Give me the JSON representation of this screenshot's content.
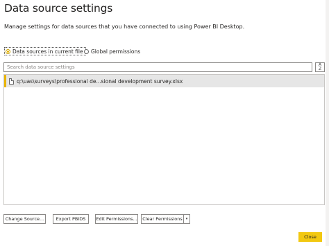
{
  "dialog": {
    "title": "Data source settings",
    "subtitle": "Manage settings for data sources that you have connected to using Power BI Desktop."
  },
  "scope": {
    "options": [
      {
        "label": "Data sources in current file",
        "selected": true
      },
      {
        "label": "Global permissions",
        "selected": false
      }
    ]
  },
  "search": {
    "placeholder": "Search data source settings",
    "sort_icon": "sort-az-icon",
    "sort_glyph_top": "A",
    "sort_glyph_bottom": "Z"
  },
  "sources": [
    {
      "label": "q:\\uas\\surveys\\professional de...sional development survey.xlsx",
      "icon": "file-icon",
      "selected": true
    }
  ],
  "buttons": {
    "change_source": "Change Source...",
    "export_pbids": "Export PBIDS",
    "edit_permissions": "Edit Permissions...",
    "clear_permissions": "Clear Permissions",
    "clear_dropdown": "▾",
    "close": "Close"
  },
  "colors": {
    "accent": "#f2c811",
    "selection": "#e6e6e6"
  }
}
